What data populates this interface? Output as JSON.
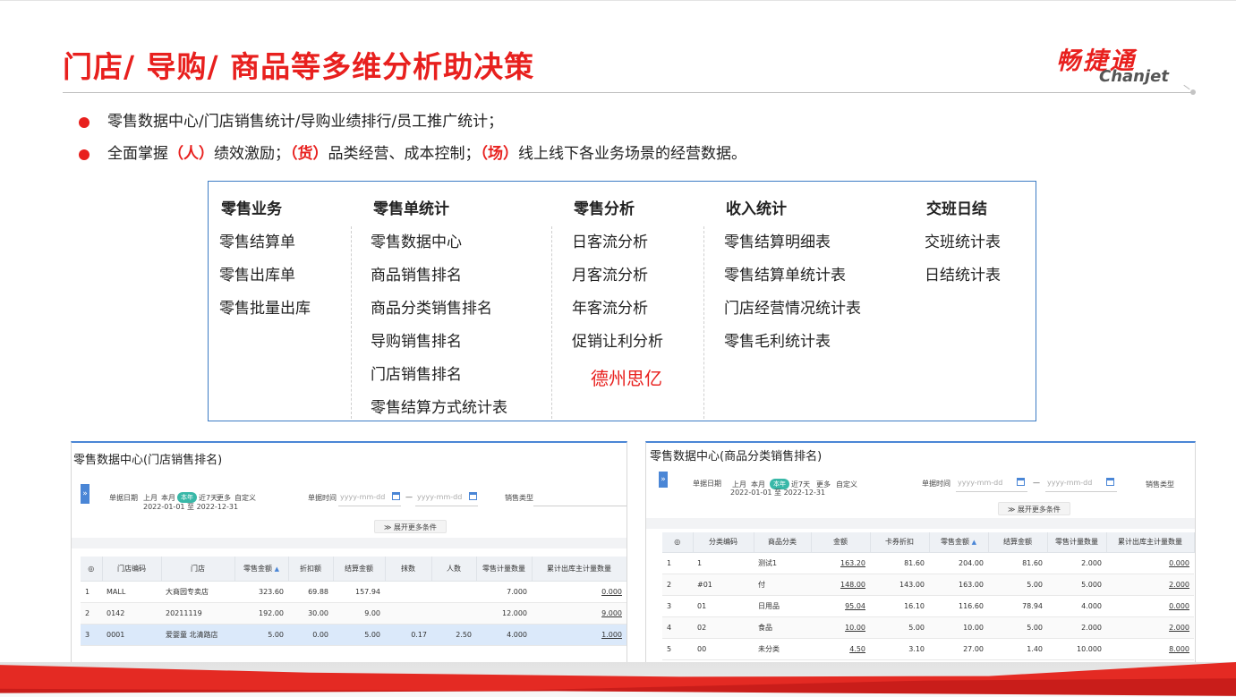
{
  "title": "门店/ 导购/ 商品等多维分析助决策",
  "logo": {
    "cn": "畅捷通",
    "en": "Chanjet"
  },
  "bullets": {
    "line1": "零售数据中心/门店销售统计/导购业绩排行/员工推广统计；",
    "line2": {
      "p1": "全面掌握",
      "r1": "（人）",
      "p2": "绩效激励；",
      "r2": "（货）",
      "p3": "品类经营、成本控制；",
      "r3": "（场）",
      "p4": "线上线下各业务场景的经营数据。"
    }
  },
  "menu": {
    "columns": [
      {
        "head": "零售业务",
        "items": [
          "零售结算单",
          "零售出库单",
          "零售批量出库"
        ]
      },
      {
        "head": "零售单统计",
        "items": [
          "零售数据中心",
          "商品销售排名",
          "商品分类销售排名",
          "导购销售排名",
          "门店销售排名",
          "零售结算方式统计表"
        ]
      },
      {
        "head": "零售分析",
        "items": [
          "日客流分析",
          "月客流分析",
          "年客流分析",
          "促销让利分析"
        ]
      },
      {
        "head": "收入统计",
        "items": [
          "零售结算明细表",
          "零售结算单统计表",
          "门店经营情况统计表",
          "零售毛利统计表"
        ]
      },
      {
        "head": "交班日结",
        "items": [
          "交班统计表",
          "日结统计表"
        ]
      }
    ],
    "watermark": "德州思亿"
  },
  "left_panel": {
    "title": "零售数据中心(门店销售排名)",
    "side_tab": "»",
    "filter": {
      "date_label": "单据日期",
      "quick": [
        "上月",
        "本月",
        "本年",
        "近7天",
        "更多",
        "自定义"
      ],
      "active": "本年",
      "range": "2022-01-01 至 2022-12-31",
      "time_label": "单据时间",
      "ph_start": "yyyy-mm-dd",
      "ph_end": "yyyy-mm-dd",
      "dash": "—",
      "type_label": "销售类型",
      "expand": "≫ 展开更多条件"
    },
    "table": {
      "headers": [
        "◎",
        "门店编码",
        "门店",
        "零售金额",
        "折扣额",
        "结算金额",
        "抹数",
        "人数",
        "零售计量数量",
        "累计出库主计量数量"
      ],
      "rows": [
        [
          "1",
          "MALL",
          "大商园专卖店",
          "323.60",
          "69.88",
          "157.94",
          "",
          "",
          "7.000",
          "0.000"
        ],
        [
          "2",
          "0142",
          "20211119",
          "192.00",
          "30.00",
          "9.00",
          "",
          "",
          "12.000",
          "9.000"
        ],
        [
          "3",
          "0001",
          "爱婴童 北清路店",
          "5.00",
          "0.00",
          "5.00",
          "0.17",
          "2.50",
          "4.000",
          "1.000"
        ]
      ]
    }
  },
  "right_panel": {
    "title": "零售数据中心(商品分类销售排名)",
    "side_tab": "»",
    "filter": {
      "date_label": "单据日期",
      "quick": [
        "上月",
        "本月",
        "本年",
        "近7天",
        "更多",
        "自定义"
      ],
      "active": "本年",
      "range": "2022-01-01 至 2022-12-31",
      "time_label": "单据时间",
      "ph_start": "yyyy-mm-dd",
      "ph_end": "yyyy-mm-dd",
      "dash": "—",
      "type_label": "销售类型",
      "expand": "≫ 展开更多条件"
    },
    "table": {
      "headers": [
        "◎",
        "分类编码",
        "商品分类",
        "金额",
        "卡券折扣",
        "零售金额",
        "结算金额",
        "零售计量数量",
        "累计出库主计量数量"
      ],
      "rows": [
        [
          "1",
          "1",
          "测试1",
          "163.20",
          "81.60",
          "204.00",
          "81.60",
          "2.000",
          "0.000"
        ],
        [
          "2",
          "#01",
          "付",
          "148.00",
          "143.00",
          "163.00",
          "5.00",
          "5.000",
          "2.000"
        ],
        [
          "3",
          "01",
          "日用品",
          "95.04",
          "16.10",
          "116.60",
          "78.94",
          "4.000",
          "0.000"
        ],
        [
          "4",
          "02",
          "食品",
          "10.00",
          "5.00",
          "10.00",
          "5.00",
          "2.000",
          "2.000"
        ],
        [
          "5",
          "00",
          "未分类",
          "4.50",
          "3.10",
          "27.00",
          "1.40",
          "10.000",
          "8.000"
        ]
      ]
    }
  }
}
